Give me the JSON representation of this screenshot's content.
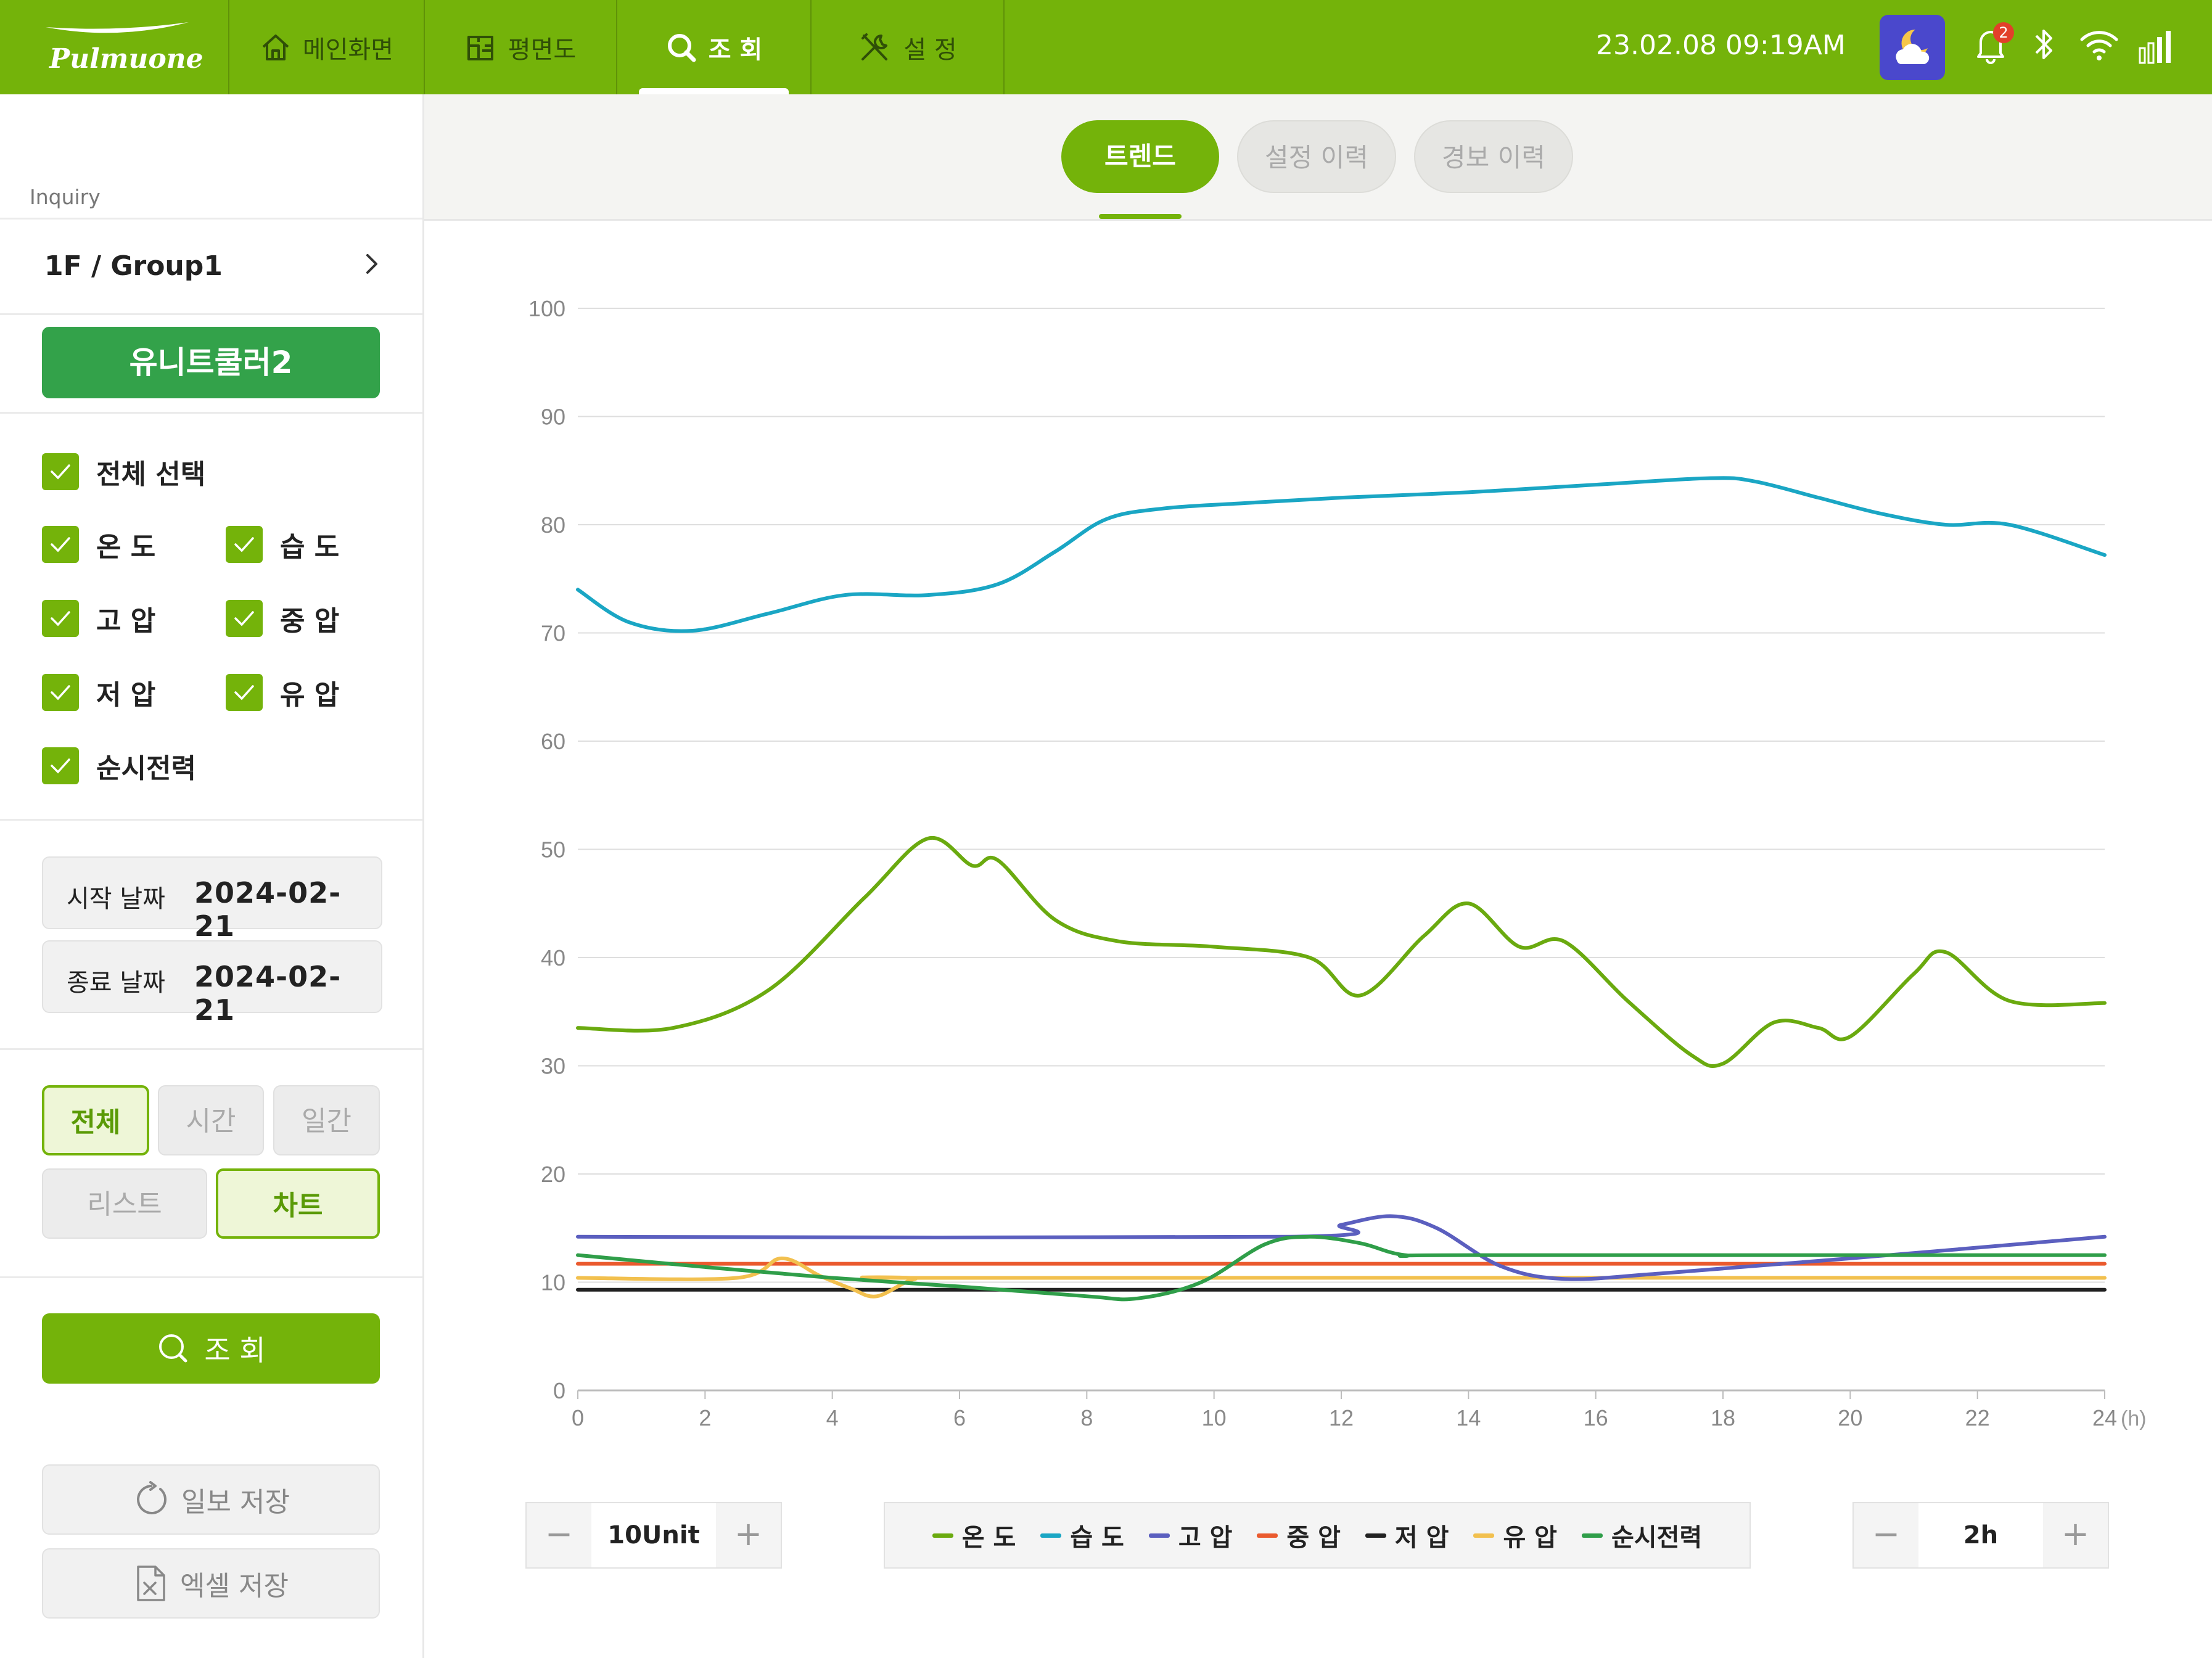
{
  "brand": {
    "logo_text": "Pulmuone"
  },
  "nav": [
    {
      "label": "메인화면",
      "icon": "home-icon"
    },
    {
      "label": "평면도",
      "icon": "floorplan-icon"
    },
    {
      "label": "조 회",
      "icon": "search-icon",
      "active": true
    },
    {
      "label": "설 정",
      "icon": "tools-icon"
    }
  ],
  "status": {
    "datetime": "23.02.08  09:19AM",
    "notification_count": "2",
    "icons": [
      "weather-night-icon",
      "bell-icon",
      "bluetooth-icon",
      "wifi-icon",
      "signal-icon"
    ]
  },
  "sidebar": {
    "section_label": "Inquiry",
    "group": "1F / Group1",
    "unit": "유니트쿨러2",
    "checkboxes": {
      "all": "전체 선택",
      "temp": "온 도",
      "humidity": "습 도",
      "high_pressure": "고 압",
      "mid_pressure": "중 압",
      "low_pressure": "저 압",
      "oil_pressure": "유 압",
      "power": "순시전력"
    },
    "start_date_label": "시작 날짜",
    "start_date": "2024-02-21",
    "end_date_label": "종료 날짜",
    "end_date": "2024-02-21",
    "period": {
      "all": "전체",
      "hour": "시간",
      "day": "일간"
    },
    "view": {
      "list": "리스트",
      "chart": "차트"
    },
    "search_label": "조 회",
    "save_report_label": "일보 저장",
    "save_excel_label": "엑셀 저장"
  },
  "tabs": {
    "trend": "트렌드",
    "settings_history": "설정 이력",
    "alarm_history": "경보 이력"
  },
  "controls": {
    "unit_value": "10Unit",
    "interval_value": "2h",
    "minus": "−",
    "plus": "+"
  },
  "colors": {
    "brand_green": "#74b30a",
    "temp": "#6aaa0f",
    "humidity": "#1aa6c4",
    "high_pressure": "#5b5fbf",
    "mid_pressure": "#ea5a2e",
    "low_pressure": "#222222",
    "oil_pressure": "#f2c04e",
    "power": "#2f9e49"
  },
  "chart_data": {
    "type": "line",
    "xlabel": "(h)",
    "ylabel": "",
    "xlim": [
      0,
      24
    ],
    "ylim": [
      0,
      100
    ],
    "x_ticks": [
      0,
      2,
      4,
      6,
      8,
      10,
      12,
      14,
      16,
      18,
      20,
      22,
      24
    ],
    "y_ticks": [
      0,
      10,
      20,
      30,
      40,
      50,
      60,
      70,
      80,
      90,
      100
    ],
    "grid": true,
    "legend_position": "bottom",
    "series": [
      {
        "name": "온 도",
        "color": "#6aaa0f",
        "x": [
          0,
          1.5,
          3,
          4.5,
          5.5,
          6.2,
          6.6,
          7.5,
          8.5,
          10,
          11.5,
          12.3,
          13.3,
          14,
          14.8,
          15.5,
          16.5,
          17.5,
          18,
          18.8,
          19.5,
          20,
          21,
          21.5,
          22.5,
          24
        ],
        "y": [
          33.5,
          33.5,
          37,
          45.5,
          51,
          48.5,
          49,
          43.5,
          41.5,
          41,
          40,
          36.5,
          42,
          45,
          41,
          41.5,
          36,
          31,
          30.2,
          34,
          33.5,
          32.7,
          38.5,
          40.5,
          36,
          35.8
        ]
      },
      {
        "name": "습 도",
        "color": "#1aa6c4",
        "x": [
          0,
          0.8,
          1.8,
          3,
          4.2,
          5.5,
          6.6,
          7.5,
          8.3,
          9.2,
          10.5,
          12,
          14,
          16,
          17.8,
          18.5,
          19.5,
          20.5,
          21.5,
          22.5,
          24
        ],
        "y": [
          74,
          71,
          70.2,
          71.8,
          73.5,
          73.5,
          74.5,
          77.5,
          80.5,
          81.5,
          82,
          82.5,
          83,
          83.7,
          84.3,
          84,
          82.5,
          81,
          80,
          80,
          77.2
        ]
      },
      {
        "name": "고 압",
        "color": "#5b5fbf",
        "x": [
          0,
          11.2,
          12,
          12.8,
          13.5,
          14.5,
          15.5,
          17,
          20,
          24
        ],
        "y": [
          14.2,
          14.2,
          15.3,
          16.1,
          15,
          11.5,
          10.3,
          10.8,
          12.2,
          14.2
        ]
      },
      {
        "name": "중 압",
        "color": "#ea5a2e",
        "x": [
          0,
          24
        ],
        "y": [
          11.7,
          11.7
        ]
      },
      {
        "name": "저 압",
        "color": "#222222",
        "x": [
          0,
          24
        ],
        "y": [
          9.3,
          9.3
        ]
      },
      {
        "name": "유 압",
        "color": "#f2c04e",
        "x": [
          0,
          2.5,
          3.2,
          3.8,
          4.3,
          4.7,
          5.3,
          6,
          24
        ],
        "y": [
          10.4,
          10.4,
          12.2,
          10.6,
          9.4,
          8.7,
          10.3,
          10.4,
          10.4
        ]
      },
      {
        "name": "순시전력",
        "color": "#2f9e49",
        "x": [
          0,
          2,
          4,
          6,
          8,
          8.8,
          9.8,
          10.8,
          11.5,
          12.3,
          13,
          14,
          24
        ],
        "y": [
          12.5,
          11.4,
          10.4,
          9.6,
          8.7,
          8.5,
          10,
          13.5,
          14.2,
          13.6,
          12.5,
          12.5,
          12.5
        ]
      }
    ]
  }
}
